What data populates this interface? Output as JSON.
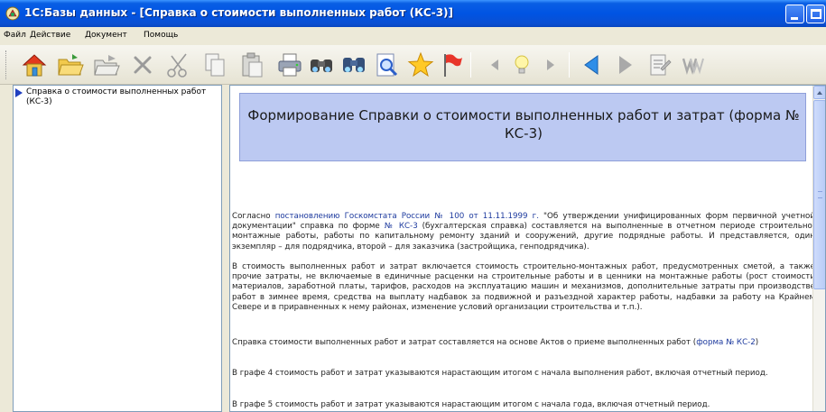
{
  "window": {
    "title": "1С:Базы данных - [Справка о стоимости выполненных работ (КС-3)]"
  },
  "menu": {
    "items": [
      "Файл",
      "Действие",
      "Документ",
      "Помощь"
    ]
  },
  "toolbar": {
    "icons": [
      "home-icon",
      "open-folder-icon",
      "folder-arrow-icon",
      "delete-icon",
      "cut-icon",
      "copy-icon",
      "paste-icon",
      "print-icon",
      "find-icon",
      "find-next-icon",
      "preview-icon",
      "favorites-star-icon",
      "bookmark-flag-icon",
      "back-small-icon",
      "hint-bulb-icon",
      "forward-small-icon",
      "back-icon",
      "forward-icon",
      "properties-icon",
      "word-icon"
    ]
  },
  "tree": {
    "items": [
      {
        "label": "Справка о стоимости выполненных работ (КС-3)"
      }
    ]
  },
  "document": {
    "heading": "Формирование Справки о стоимости выполненных работ и затрат (форма № КС-3)",
    "p1": {
      "a": "Согласно ",
      "link1": "постановлению Госкомстата России № 100 от 11.11.1999 г.",
      "b": " \"Об утверждении унифицированных форм первичной учетной документации\" справка по форме ",
      "link2": "№ КС-3",
      "c": " (бухгалтерская справка) составляется на выполненные в отчетном периоде строительно-монтажные работы, работы по капитальному ремонту зданий и сооружений, другие подрядные работы. И представляется, один экземпляр – для подрядчика, второй – для заказчика (застройщика, генподрядчика)."
    },
    "p2": "В стоимость выполненных работ и затрат включается стоимость строительно-монтажных работ, предусмотренных сметой, а также прочие затраты, не включаемые в единичные расценки на строительные работы и в ценники на монтажные работы (рост стоимости материалов, заработной платы, тарифов, расходов на эксплуатацию машин и механизмов, дополнительные затраты при производстве работ в зимнее время, средства на выплату надбавок за подвижной и разъездной характер работы, надбавки за работу на Крайнем Севере и в приравненных к нему районах, изменение условий организации строительства и т.п.).",
    "p3": {
      "a": "Справка стоимости выполненных работ и затрат составляется на основе Актов о приеме выполненных работ (",
      "link": "форма № КС-2",
      "b": ")"
    },
    "p4": "В графе 4 стоимость работ и затрат указываются нарастающим итогом с начала выполнения работ, включая отчетный период.",
    "p5": "В графе 5 стоимость работ и затрат указываются нарастающим итогом с начала года, включая отчетный период."
  },
  "colors": {
    "titlebar": "#0054e3",
    "heading_box": "#bcc9f2",
    "link": "#1d3a9e"
  }
}
